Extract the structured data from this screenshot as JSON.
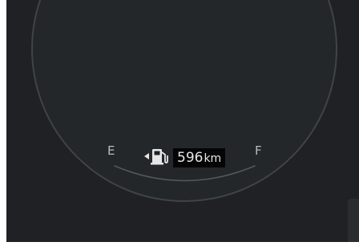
{
  "fuel_gauge": {
    "empty_label": "E",
    "full_label": "F",
    "range_value": "596",
    "range_unit": "km",
    "fuel_door_side": "left",
    "pump_icon": "fuel-pump-icon",
    "side_arrow_icon": "left-arrow-icon"
  },
  "colors": {
    "background": "#1f2124",
    "dial": "#24272a",
    "dial_ring": "#404347",
    "text": "#b9bbbd",
    "range_bg": "#050505"
  }
}
